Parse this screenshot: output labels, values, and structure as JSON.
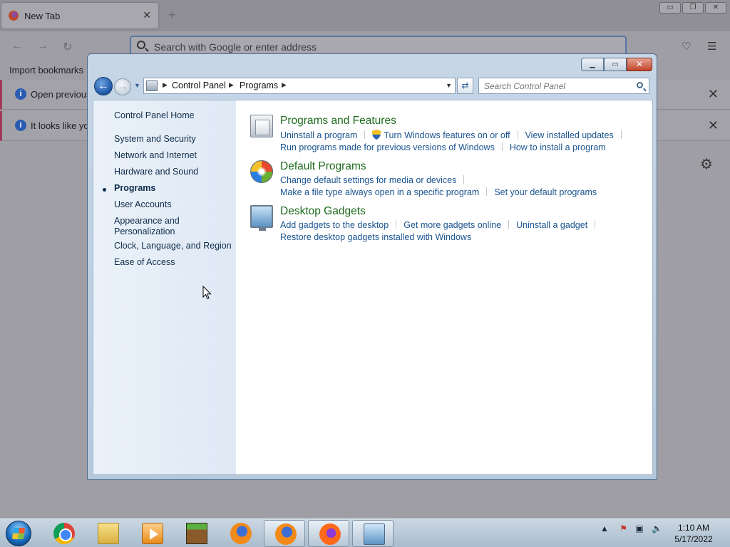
{
  "firefox": {
    "tab_title": "New Tab",
    "tab_close": "✕",
    "new_tab": "+",
    "url_placeholder": "Search with Google or enter address",
    "import_bookmarks": "Import bookmarks",
    "notice1_text": "Open previous",
    "notice2_text": "It looks like you",
    "window_min": "▭",
    "window_max": "❐",
    "window_close": "✕"
  },
  "control_panel": {
    "breadcrumb": [
      "Control Panel",
      "Programs"
    ],
    "search_placeholder": "Search Control Panel",
    "sidebar": {
      "home": "Control Panel Home",
      "items": [
        "System and Security",
        "Network and Internet",
        "Hardware and Sound",
        "Programs",
        "User Accounts",
        "Appearance and\nPersonalization",
        "Clock, Language, and Region",
        "Ease of Access"
      ],
      "active_index": 3
    },
    "categories": [
      {
        "title": "Programs and Features",
        "icon": "programs-features-icon",
        "rows": [
          [
            "Uninstall a program",
            "Turn Windows features on or off",
            "View installed updates"
          ],
          [
            "Run programs made for previous versions of Windows",
            "How to install a program"
          ]
        ]
      },
      {
        "title": "Default Programs",
        "icon": "default-programs-icon",
        "rows": [
          [
            "Change default settings for media or devices"
          ],
          [
            "Make a file type always open in a specific program",
            "Set your default programs"
          ]
        ]
      },
      {
        "title": "Desktop Gadgets",
        "icon": "desktop-gadgets-icon",
        "rows": [
          [
            "Add gadgets to the desktop",
            "Get more gadgets online",
            "Uninstall a gadget"
          ],
          [
            "Restore desktop gadgets installed with Windows"
          ]
        ]
      }
    ]
  },
  "taskbar": {
    "time": "1:10 AM",
    "date": "5/17/2022",
    "tray_arrow": "▲"
  }
}
